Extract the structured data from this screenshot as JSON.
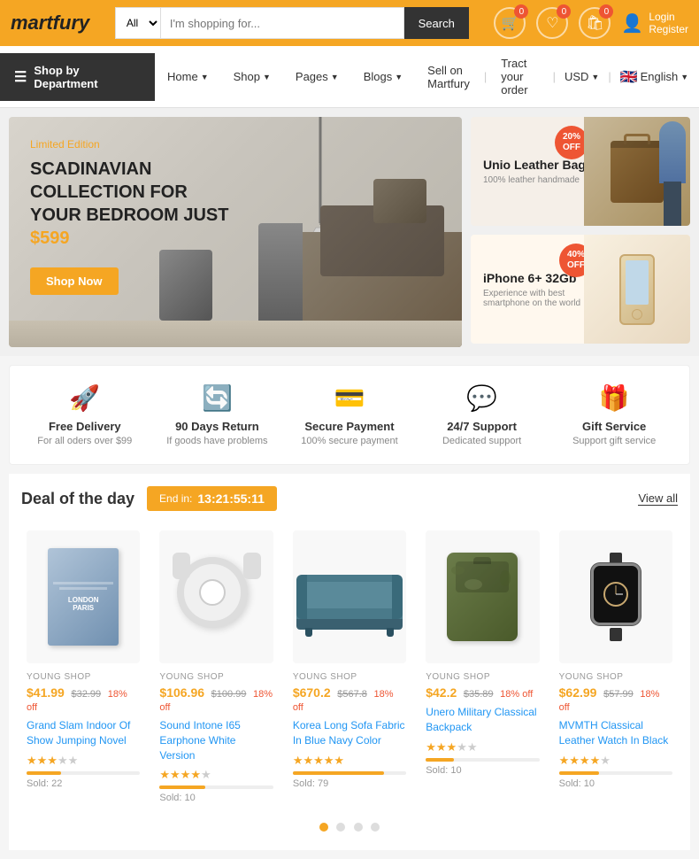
{
  "header": {
    "logo": "martfury",
    "search": {
      "category": "All",
      "placeholder": "I'm shopping for...",
      "button": "Search"
    },
    "icons": {
      "cart_count": "0",
      "wishlist_count": "0",
      "compare_count": "0"
    },
    "user": {
      "login": "Login",
      "register": "Register"
    }
  },
  "nav": {
    "shop_dept": "Shop by Department",
    "links": [
      "Home",
      "Shop",
      "Pages",
      "Blogs",
      "Sell on Martfury",
      "Tract your order"
    ],
    "currency": "USD",
    "language": "English"
  },
  "main_banner": {
    "badge": "Limited Edition",
    "title": "SCADINAVIAN COLLECTION FOR YOUR BEDROOM JUST",
    "price": "$599",
    "button": "Shop Now"
  },
  "side_banners": [
    {
      "title": "Unio Leather Bags",
      "desc": "100% leather handmade",
      "badge": "20%\nOFF"
    },
    {
      "title": "iPhone 6+ 32Gb",
      "desc": "Experience with best smartphone on the world",
      "badge": "40%\nOFF"
    }
  ],
  "features": [
    {
      "icon": "🚀",
      "title": "Free Delivery",
      "desc": "For all oders over $99"
    },
    {
      "icon": "🔄",
      "title": "90 Days Return",
      "desc": "If goods have problems"
    },
    {
      "icon": "💳",
      "title": "Secure Payment",
      "desc": "100% secure payment"
    },
    {
      "icon": "💬",
      "title": "24/7 Support",
      "desc": "Dedicated support"
    },
    {
      "icon": "🎁",
      "title": "Gift Service",
      "desc": "Support gift service"
    }
  ],
  "deals": {
    "title": "Deal of the day",
    "end_in_label": "End in:",
    "countdown": "13:21:55:11",
    "view_all": "View all"
  },
  "products": [
    {
      "shop": "YOUNG SHOP",
      "price": "$41.99",
      "old_price": "$32.99",
      "discount": "18% off",
      "name": "Grand Slam Indoor Of Show Jumping Novel",
      "stars": 3.5,
      "sold": 22,
      "sold_pct": 30,
      "color": "#5577aa"
    },
    {
      "shop": "YOUNG SHOP",
      "price": "$106.96",
      "old_price": "$100.99",
      "discount": "18% off",
      "name": "Sound Intone I65 Earphone White Version",
      "stars": 4,
      "sold": 10,
      "sold_pct": 40,
      "color": "#dddddd"
    },
    {
      "shop": "YOUNG SHOP",
      "price": "$670.2",
      "old_price": "$567.8",
      "discount": "18% off",
      "name": "Korea Long Sofa Fabric In Blue Navy Color",
      "stars": 5,
      "sold": 79,
      "sold_pct": 80,
      "color": "#4a7a8a"
    },
    {
      "shop": "YOUNG SHOP",
      "price": "$42.2",
      "old_price": "$35.89",
      "discount": "18% off",
      "name": "Unero Military Classical Backpack",
      "stars": 3,
      "sold": 10,
      "sold_pct": 25,
      "color": "#6b7c4a"
    },
    {
      "shop": "YOUNG SHOP",
      "price": "$62.99",
      "old_price": "$57.99",
      "discount": "18% off",
      "name": "MVMTH Classical Leather Watch In Black",
      "stars": 4,
      "sold": 10,
      "sold_pct": 35,
      "color": "#222222"
    }
  ],
  "carousel": {
    "dots": [
      true,
      false,
      false,
      false
    ]
  }
}
